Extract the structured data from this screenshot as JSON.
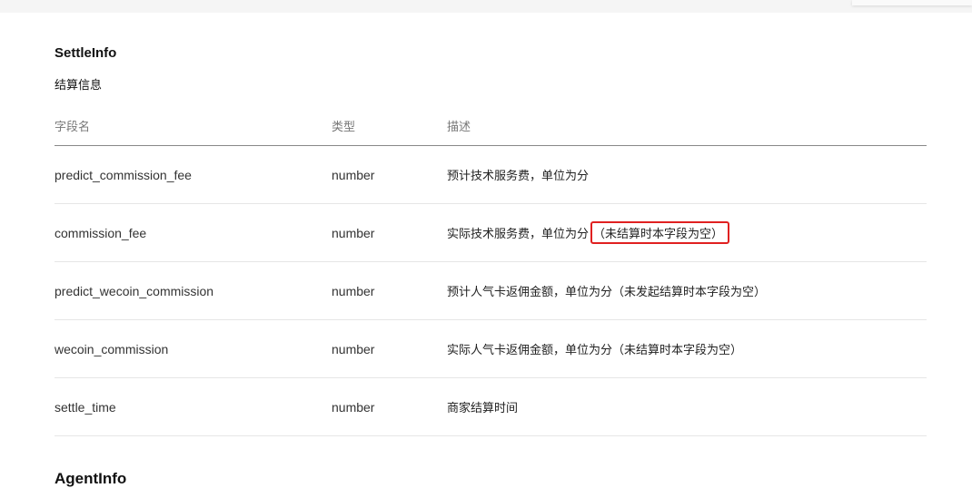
{
  "section": {
    "title": "SettleInfo",
    "description": "结算信息"
  },
  "table": {
    "headers": [
      "字段名",
      "类型",
      "描述"
    ],
    "rows": [
      {
        "field": "predict_commission_fee",
        "type": "number",
        "desc": "预计技术服务费，单位为分",
        "note": ""
      },
      {
        "field": "commission_fee",
        "type": "number",
        "desc": "实际技术服务费，单位为分",
        "note": "（未结算时本字段为空）"
      },
      {
        "field": "predict_wecoin_commission",
        "type": "number",
        "desc": "预计人气卡返佣金额，单位为分（未发起结算时本字段为空）",
        "note": ""
      },
      {
        "field": "wecoin_commission",
        "type": "number",
        "desc": "实际人气卡返佣金额，单位为分（未结算时本字段为空）",
        "note": ""
      },
      {
        "field": "settle_time",
        "type": "number",
        "desc": "商家结算时间",
        "note": ""
      }
    ]
  },
  "next_section": {
    "title": "AgentInfo"
  },
  "colors": {
    "highlight_border": "#e02020"
  }
}
